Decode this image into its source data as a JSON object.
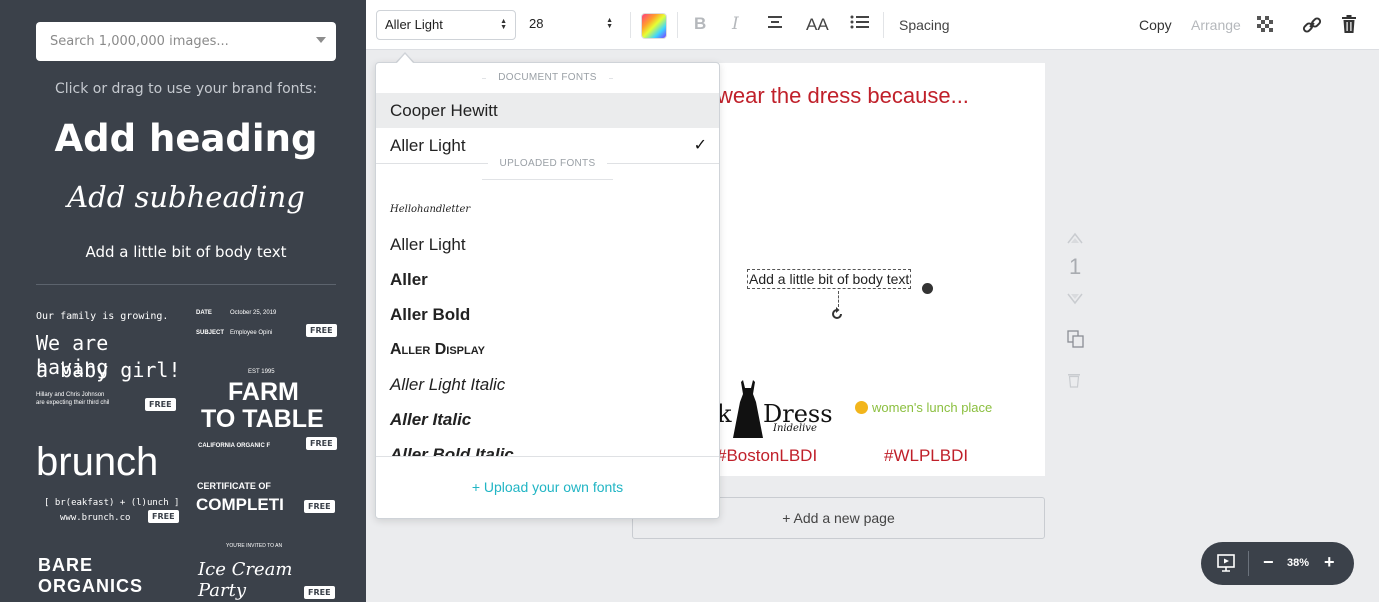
{
  "sidebar": {
    "search_placeholder": "Search 1,000,000 images...",
    "brand_hint": "Click or drag to use your brand fonts:",
    "add_heading": "Add heading",
    "add_subheading": "Add subheading",
    "add_body": "Add a little bit of body text",
    "free_label": "FREE",
    "templates": {
      "baby_line1": "Our family is growing.",
      "baby_line2": "We are having",
      "baby_line3": "a baby girl!",
      "baby_line4": "Hillary and Chris Johnson",
      "baby_line5": "are expecting their third chil",
      "memo_date_label": "DATE",
      "memo_date_value": "October 25, 2019",
      "memo_subject_label": "SUBJECT",
      "memo_subject_value": "Employee Opini",
      "farm_est": "EST 1995",
      "farm_line1": "FARM",
      "farm_line2": "TO TABLE",
      "farm_sub": "CALIFORNIA ORGANIC F",
      "brunch_title": "brunch",
      "brunch_line1": "[ br(eakfast) + (l)unch ]",
      "brunch_line2": "www.brunch.co",
      "cert_line1": "CERTIFICATE OF",
      "cert_line2": "COMPLETI",
      "bare_line1": "BARE",
      "bare_line2": "ORGANICS",
      "ice_invite": "YOU'RE INVITED TO AN",
      "ice_title": "Ice Cream Party"
    }
  },
  "toolbar": {
    "font_value": "Aller Light",
    "size_value": "28",
    "bold": "B",
    "italic": "I",
    "case": "AA",
    "spacing": "Spacing",
    "copy": "Copy",
    "arrange": "Arrange"
  },
  "font_dropdown": {
    "document_fonts_label": "DOCUMENT FONTS",
    "uploaded_fonts_label": "UPLOADED FONTS",
    "document_fonts": [
      "Cooper Hewitt",
      "Aller Light"
    ],
    "uploaded_fonts": [
      "Hellohandletter",
      "Aller Light",
      "Aller",
      "Aller Bold",
      "Aller Display",
      "Aller Light Italic",
      "Aller Italic",
      "Aller Bold Italic"
    ],
    "selected_font": "Aller Light",
    "upload_label": "+ Upload your own fonts"
  },
  "canvas": {
    "heading": "wear the dress because...",
    "selected_text": "Add a little bit of body text",
    "dress_logo_text": "Dress",
    "dress_logo_sub": "Inidelive",
    "dress_logo_prefix": "k",
    "wlp_logo_text": "women's lunch place",
    "hashtag_left": "#BostonLBDI",
    "hashtag_right": "#WLPLBDI"
  },
  "pages": {
    "page_number": "1",
    "add_page_label": "+ Add a new page"
  },
  "zoom": {
    "level": "38%",
    "minus": "−",
    "plus": "+"
  }
}
